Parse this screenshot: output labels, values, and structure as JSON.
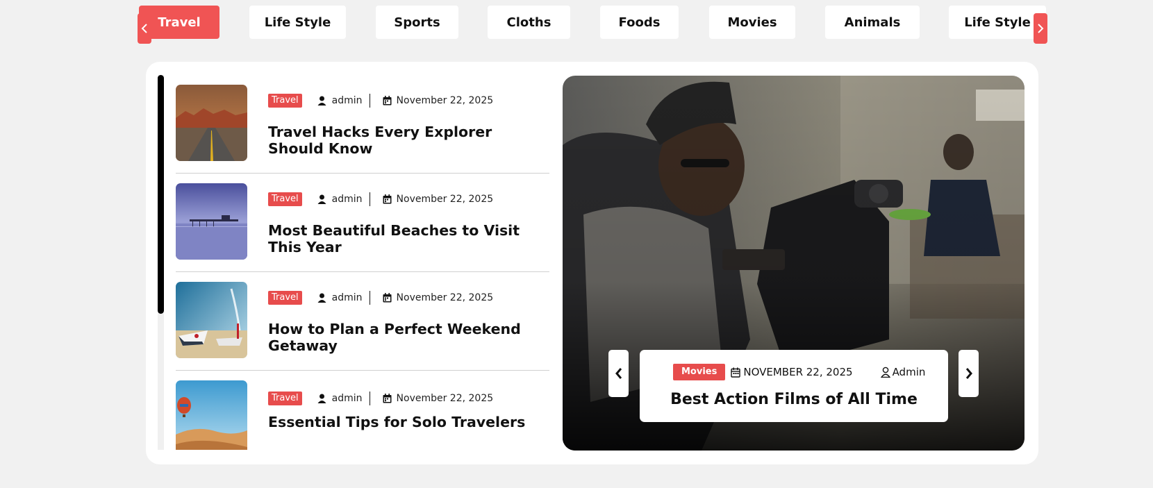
{
  "categories": {
    "tabs": [
      {
        "label": "Travel",
        "active": true
      },
      {
        "label": "Life Style",
        "active": false
      },
      {
        "label": "Sports",
        "active": false
      },
      {
        "label": "Cloths",
        "active": false
      },
      {
        "label": "Foods",
        "active": false
      },
      {
        "label": "Movies",
        "active": false
      },
      {
        "label": "Animals",
        "active": false
      },
      {
        "label": "Life Style",
        "active": false
      }
    ],
    "prev_icon": "chevron-left-icon",
    "next_icon": "chevron-right-icon"
  },
  "posts": [
    {
      "category": "Travel",
      "author": "admin",
      "date": "November 22, 2025",
      "title": "Travel Hacks Every Explorer Should Know",
      "thumbnail": "desert-road-photo"
    },
    {
      "category": "Travel",
      "author": "admin",
      "date": "November 22, 2025",
      "title": "Most Beautiful Beaches to Visit This Year",
      "thumbnail": "pier-at-dusk-photo"
    },
    {
      "category": "Travel",
      "author": "admin",
      "date": "November 22, 2025",
      "title": "How to Plan a Perfect Weekend Getaway",
      "thumbnail": "boats-on-beach-photo"
    },
    {
      "category": "Travel",
      "author": "admin",
      "date": "November 22, 2025",
      "title": "Essential Tips for Solo Travelers",
      "thumbnail": "desert-balloon-photo"
    }
  ],
  "hero": {
    "category": "Movies",
    "date": "NOVEMBER 22, 2025",
    "author": "Admin",
    "title": "Best Action Films of All Time",
    "image": "cameraman-photo"
  },
  "colors": {
    "accent": "#f05454",
    "badge": "#e74c4c",
    "page_bg": "#f1f1f1",
    "card_bg": "#ffffff"
  }
}
